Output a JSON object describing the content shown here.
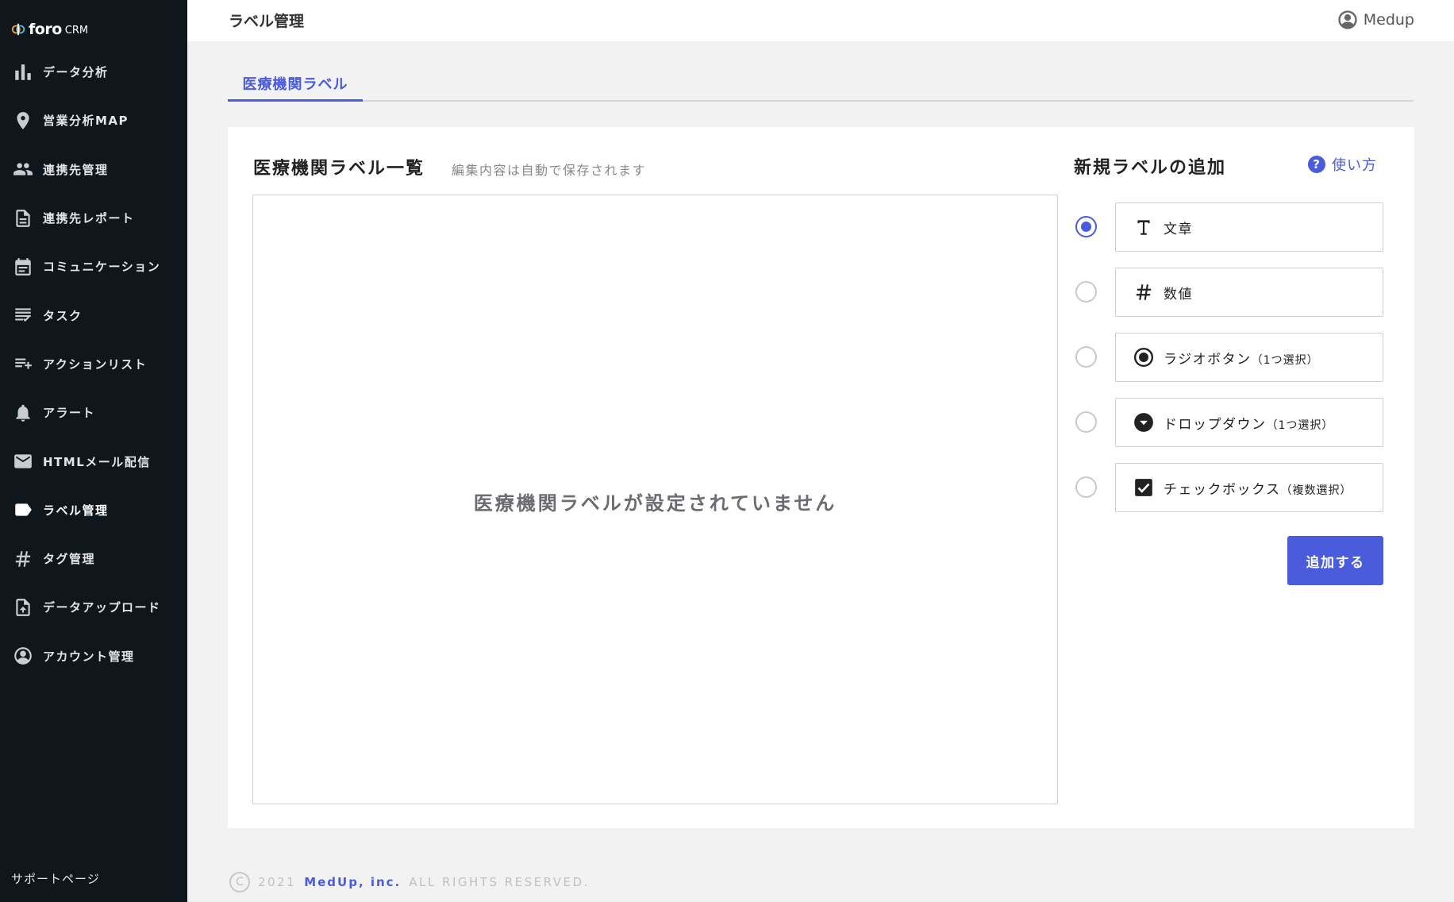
{
  "brand": {
    "name": "foro",
    "suffix": "CRM"
  },
  "sidebar": {
    "items": [
      {
        "label": "データ分析",
        "icon": "bar-chart-icon"
      },
      {
        "label": "営業分析MAP",
        "icon": "map-pin-icon"
      },
      {
        "label": "連携先管理",
        "icon": "people-icon"
      },
      {
        "label": "連携先レポート",
        "icon": "document-icon"
      },
      {
        "label": "コミュニケーション",
        "icon": "calendar-icon"
      },
      {
        "label": "タスク",
        "icon": "task-list-icon"
      },
      {
        "label": "アクションリスト",
        "icon": "playlist-add-icon"
      },
      {
        "label": "アラート",
        "icon": "bell-icon"
      },
      {
        "label": "HTMLメール配信",
        "icon": "mail-icon"
      },
      {
        "label": "ラベル管理",
        "icon": "label-icon",
        "active": true
      },
      {
        "label": "タグ管理",
        "icon": "hash-icon"
      },
      {
        "label": "データアップロード",
        "icon": "upload-file-icon"
      },
      {
        "label": "アカウント管理",
        "icon": "account-circle-icon"
      }
    ],
    "support": "サポートページ"
  },
  "header": {
    "title": "ラベル管理",
    "user": "Medup"
  },
  "tabs": [
    {
      "label": "医療機関ラベル",
      "active": true
    }
  ],
  "list": {
    "title": "医療機関ラベル一覧",
    "subtitle": "編集内容は自動で保存されます",
    "empty": "医療機関ラベルが設定されていません"
  },
  "add": {
    "title": "新規ラベルの追加",
    "howto": "使い方",
    "options": [
      {
        "label": "文章",
        "sub": "",
        "icon": "text-icon",
        "selected": true
      },
      {
        "label": "数値",
        "sub": "",
        "icon": "hash-icon",
        "selected": false
      },
      {
        "label": "ラジオボタン",
        "sub": "（1つ選択）",
        "icon": "radio-icon",
        "selected": false
      },
      {
        "label": "ドロップダウン",
        "sub": "（1つ選択）",
        "icon": "dropdown-icon",
        "selected": false
      },
      {
        "label": "チェックボックス",
        "sub": "（複数選択）",
        "icon": "checkbox-icon",
        "selected": false
      }
    ],
    "button": "追加する"
  },
  "footer": {
    "symbol": "C",
    "year": "2021",
    "company": "MedUp, inc.",
    "rights": "ALL RIGHTS RESERVED."
  },
  "colors": {
    "accent": "#4a5bdc",
    "sidebar": "#10171c",
    "background": "#f2f2f3"
  }
}
